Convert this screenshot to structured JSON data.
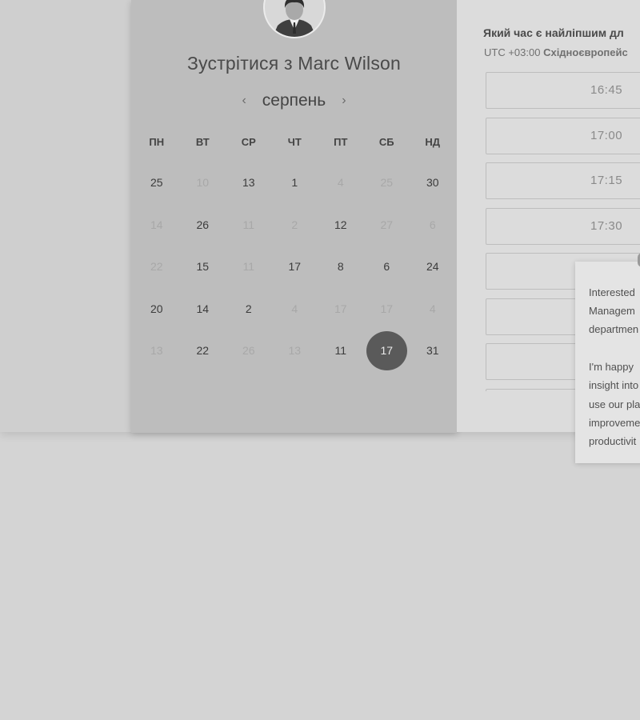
{
  "scheduler": {
    "title": "Зустрітися з Marc Wilson",
    "month": "серпень",
    "prev_icon": "‹",
    "next_icon": "›",
    "weekdays": [
      "ПН",
      "ВТ",
      "СР",
      "ЧТ",
      "ПТ",
      "СБ",
      "НД"
    ],
    "days": [
      {
        "label": "25",
        "available": true
      },
      {
        "label": "10",
        "available": false
      },
      {
        "label": "13",
        "available": true
      },
      {
        "label": "1",
        "available": true
      },
      {
        "label": "4",
        "available": false
      },
      {
        "label": "25",
        "available": false
      },
      {
        "label": "30",
        "available": true
      },
      {
        "label": "14",
        "available": false
      },
      {
        "label": "26",
        "available": true
      },
      {
        "label": "11",
        "available": false
      },
      {
        "label": "2",
        "available": false
      },
      {
        "label": "12",
        "available": true
      },
      {
        "label": "27",
        "available": false
      },
      {
        "label": "6",
        "available": false
      },
      {
        "label": "22",
        "available": false
      },
      {
        "label": "15",
        "available": true
      },
      {
        "label": "11",
        "available": false
      },
      {
        "label": "17",
        "available": true
      },
      {
        "label": "8",
        "available": true
      },
      {
        "label": "6",
        "available": true
      },
      {
        "label": "24",
        "available": true
      },
      {
        "label": "20",
        "available": true
      },
      {
        "label": "14",
        "available": true
      },
      {
        "label": "2",
        "available": true
      },
      {
        "label": "4",
        "available": false
      },
      {
        "label": "17",
        "available": false
      },
      {
        "label": "17",
        "available": false
      },
      {
        "label": "4",
        "available": false
      },
      {
        "label": "13",
        "available": false
      },
      {
        "label": "22",
        "available": true
      },
      {
        "label": "26",
        "available": false
      },
      {
        "label": "13",
        "available": false
      },
      {
        "label": "11",
        "available": true
      },
      {
        "label": "17",
        "available": true,
        "selected": true
      },
      {
        "label": "31",
        "available": true
      }
    ]
  },
  "times": {
    "question": "Який час є найліпшим дл",
    "timezone_offset": "UTC +03:00",
    "timezone_name": "Східноєвропейс",
    "slots": [
      "16:45",
      "17:00",
      "17:15",
      "17:30",
      "",
      "",
      "",
      ""
    ]
  },
  "popup": {
    "line1": "Interested",
    "line2": "Managem",
    "line3": "departmen",
    "line4": "I'm happy",
    "line5": "insight into",
    "line6": "use our pla",
    "line7": "improveme",
    "line8": "productivit"
  },
  "colors": {
    "selected_day": "#5a5a5a",
    "card": "#bdbdbd",
    "page": "#d4d4d4"
  }
}
